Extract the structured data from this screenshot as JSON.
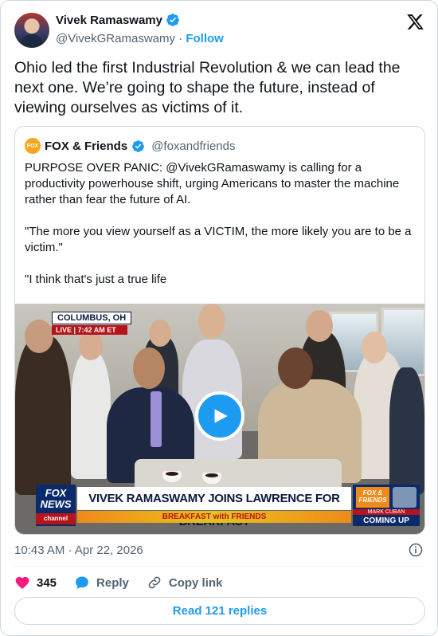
{
  "author": {
    "name": "Vivek Ramaswamy",
    "handle": "@VivekGRamaswamy",
    "separator": "·",
    "follow_label": "Follow"
  },
  "tweet": {
    "text": "Ohio led the first Industrial Revolution & we can lead the next one. We’re going to shape the future, instead of viewing ourselves as victims of it."
  },
  "quote": {
    "logo_text": "FOX",
    "name": "FOX & Friends",
    "handle": "@foxandfriends",
    "paragraphs": [
      "PURPOSE OVER PANIC: @VivekGRamaswamy is calling for a productivity powerhouse shift, urging Americans to master the machine rather than fear the future of AI.",
      "\"The more you view yourself as a VICTIM, the more likely you are to be a victim.\"",
      "\"I think that's just a true life"
    ],
    "video": {
      "location": "COLUMBUS, OH",
      "live": "LIVE | 7:42 AM ET",
      "network_logo": "FOX NEWS",
      "network_channel": "channel",
      "headline": "VIVEK RAMASWAMY JOINS LAWRENCE FOR BREAKFAST",
      "subline": "BREAKFAST with FRIENDS",
      "show_logo": "FOX & FRIENDS",
      "next_guest": "MARK CUBAN",
      "coming_up": "COMING UP"
    }
  },
  "timestamp": "10:43 AM · Apr 22, 2026",
  "actions": {
    "likes": "345",
    "reply_label": "Reply",
    "copy_label": "Copy link"
  },
  "read_replies_label": "Read 121 replies",
  "colors": {
    "accent": "#1d9bf0",
    "like": "#f91880",
    "text": "#0f1419",
    "muted": "#536471"
  }
}
